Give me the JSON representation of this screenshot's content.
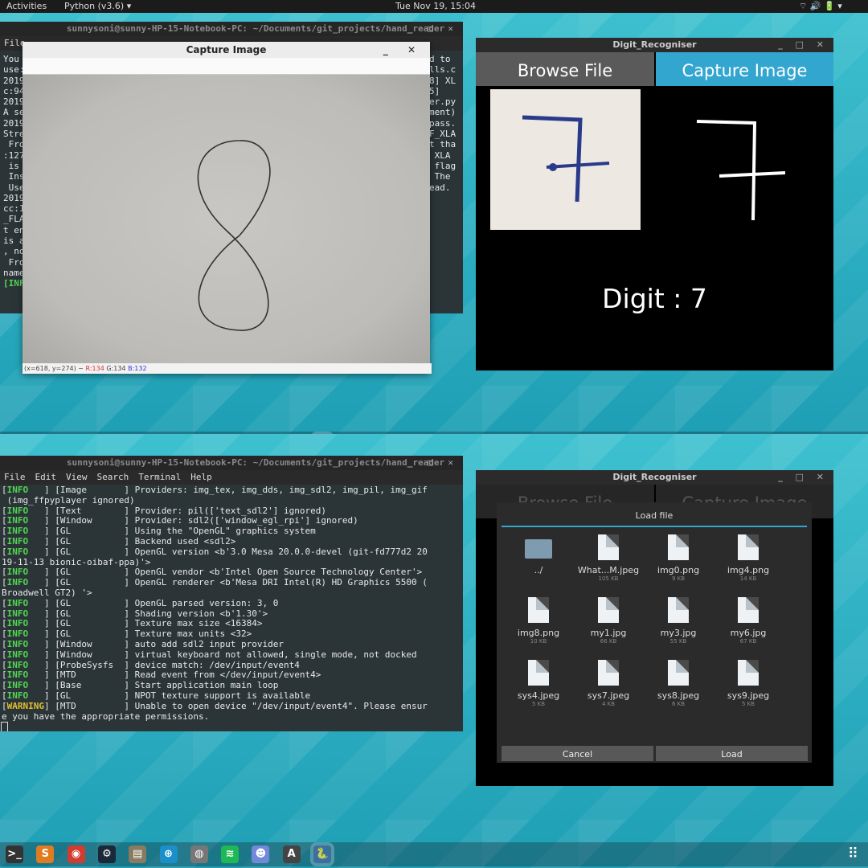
{
  "topbar": {
    "activities": "Activities",
    "app": "Python (v3.6) ▾",
    "clock": "Tue Nov 19, 15:04",
    "status_icons": "⌔ 🔊 🔋 ▾"
  },
  "top": {
    "terminal": {
      "title": "sunnysoni@sunny-HP-15-Notebook-PC: ~/Documents/git_projects/hand_reader",
      "menu": [
        "File"
      ],
      "left_fragments": [
        "You",
        "use:",
        "2019",
        "c:94",
        "2019",
        "A se",
        "2019",
        "Stre",
        " Fro",
        ":127",
        " is",
        " Ins",
        " Use",
        "2019",
        "cc:1",
        "_FLA",
        "t en",
        "is a",
        ", no",
        " Fro",
        "name",
        "",
        "[INF"
      ],
      "right_fragments": [
        "d to",
        "",
        "lls.c",
        "",
        "8] XL",
        "",
        "5]",
        "",
        "er.py",
        "ment)",
        "",
        "",
        "",
        "pass.",
        "F_XLA",
        "t tha",
        " XLA",
        " flag",
        "",
        "",
        " The",
        "ead."
      ]
    },
    "capture": {
      "title": "Capture Image",
      "status_coords": "(x=618, y=274) ~ ",
      "r": "R:134",
      "g": "G:134",
      "b": "B:132"
    },
    "digit_app": {
      "title": "Digit_Recogniser",
      "browse": "Browse File",
      "capture": "Capture Image",
      "result": "Digit : 7"
    }
  },
  "bottom": {
    "terminal": {
      "title": "sunnysoni@sunny-HP-15-Notebook-PC: ~/Documents/git_projects/hand_reader",
      "menu": [
        "File",
        "Edit",
        "View",
        "Search",
        "Terminal",
        "Help"
      ],
      "lines": [
        {
          "lvl": "INFO",
          "rest": "   ] [Image       ] Providers: img_tex, img_dds, img_sdl2, img_pil, img_gif"
        },
        {
          "lvl": "",
          "rest": " (img_ffpyplayer ignored)"
        },
        {
          "lvl": "INFO",
          "rest": "   ] [Text        ] Provider: pil(['text_sdl2'] ignored)"
        },
        {
          "lvl": "INFO",
          "rest": "   ] [Window      ] Provider: sdl2(['window_egl_rpi'] ignored)"
        },
        {
          "lvl": "INFO",
          "rest": "   ] [GL          ] Using the \"OpenGL\" graphics system"
        },
        {
          "lvl": "INFO",
          "rest": "   ] [GL          ] Backend used <sdl2>"
        },
        {
          "lvl": "INFO",
          "rest": "   ] [GL          ] OpenGL version <b'3.0 Mesa 20.0.0-devel (git-fd777d2 20"
        },
        {
          "lvl": "",
          "rest": "19-11-13 bionic-oibaf-ppa)'>"
        },
        {
          "lvl": "INFO",
          "rest": "   ] [GL          ] OpenGL vendor <b'Intel Open Source Technology Center'>"
        },
        {
          "lvl": "INFO",
          "rest": "   ] [GL          ] OpenGL renderer <b'Mesa DRI Intel(R) HD Graphics 5500 ("
        },
        {
          "lvl": "",
          "rest": "Broadwell GT2) '>"
        },
        {
          "lvl": "INFO",
          "rest": "   ] [GL          ] OpenGL parsed version: 3, 0"
        },
        {
          "lvl": "INFO",
          "rest": "   ] [GL          ] Shading version <b'1.30'>"
        },
        {
          "lvl": "INFO",
          "rest": "   ] [GL          ] Texture max size <16384>"
        },
        {
          "lvl": "INFO",
          "rest": "   ] [GL          ] Texture max units <32>"
        },
        {
          "lvl": "INFO",
          "rest": "   ] [Window      ] auto add sdl2 input provider"
        },
        {
          "lvl": "INFO",
          "rest": "   ] [Window      ] virtual keyboard not allowed, single mode, not docked"
        },
        {
          "lvl": "INFO",
          "rest": "   ] [ProbeSysfs  ] device match: /dev/input/event4"
        },
        {
          "lvl": "INFO",
          "rest": "   ] [MTD         ] Read event from </dev/input/event4>"
        },
        {
          "lvl": "INFO",
          "rest": "   ] [Base        ] Start application main loop"
        },
        {
          "lvl": "INFO",
          "rest": "   ] [GL          ] NPOT texture support is available"
        },
        {
          "lvl": "WARNING",
          "rest": "] [MTD         ] Unable to open device \"/dev/input/event4\". Please ensur"
        },
        {
          "lvl": "",
          "rest": "e you have the appropriate permissions."
        }
      ]
    },
    "digit_app": {
      "title": "Digit_Recogniser",
      "bg_browse": "Browse File",
      "bg_capture": "Capture Image",
      "dialog": {
        "title": "Load file",
        "files": [
          {
            "name": "../",
            "size": "",
            "folder": true
          },
          {
            "name": "What...M.jpeg",
            "size": "105 KB"
          },
          {
            "name": "img0.png",
            "size": "9 KB"
          },
          {
            "name": "img4.png",
            "size": "14 KB"
          },
          {
            "name": "img8.png",
            "size": "10 KB"
          },
          {
            "name": "my1.jpg",
            "size": "66 KB"
          },
          {
            "name": "my3.jpg",
            "size": "55 KB"
          },
          {
            "name": "my6.jpg",
            "size": "67 KB"
          },
          {
            "name": "sys4.jpeg",
            "size": "5 KB"
          },
          {
            "name": "sys7.jpeg",
            "size": "4 KB"
          },
          {
            "name": "sys8.jpeg",
            "size": "6 KB"
          },
          {
            "name": "sys9.jpeg",
            "size": "5 KB"
          }
        ],
        "cancel": "Cancel",
        "load": "Load"
      }
    }
  },
  "dock": {
    "apps": [
      {
        "icon": "terminal-icon",
        "glyph": ">_",
        "color": "#333"
      },
      {
        "icon": "sublime-icon",
        "glyph": "S",
        "color": "#e07b20"
      },
      {
        "icon": "chrome-icon",
        "glyph": "◉",
        "color": "#d13b30"
      },
      {
        "icon": "steam-icon",
        "glyph": "⚙",
        "color": "#1b2838"
      },
      {
        "icon": "files-icon",
        "glyph": "▤",
        "color": "#8a7a60"
      },
      {
        "icon": "mattermost-icon",
        "glyph": "⊕",
        "color": "#1a8fc9"
      },
      {
        "icon": "globe-icon",
        "glyph": "◍",
        "color": "#777"
      },
      {
        "icon": "spotify-icon",
        "glyph": "≋",
        "color": "#1db954"
      },
      {
        "icon": "discord-icon",
        "glyph": "☻",
        "color": "#7289da"
      },
      {
        "icon": "software-icon",
        "glyph": "A",
        "color": "#444"
      },
      {
        "icon": "python-icon",
        "glyph": "🐍",
        "color": "#3a6fa0"
      }
    ],
    "grid_icon": "⠿"
  }
}
